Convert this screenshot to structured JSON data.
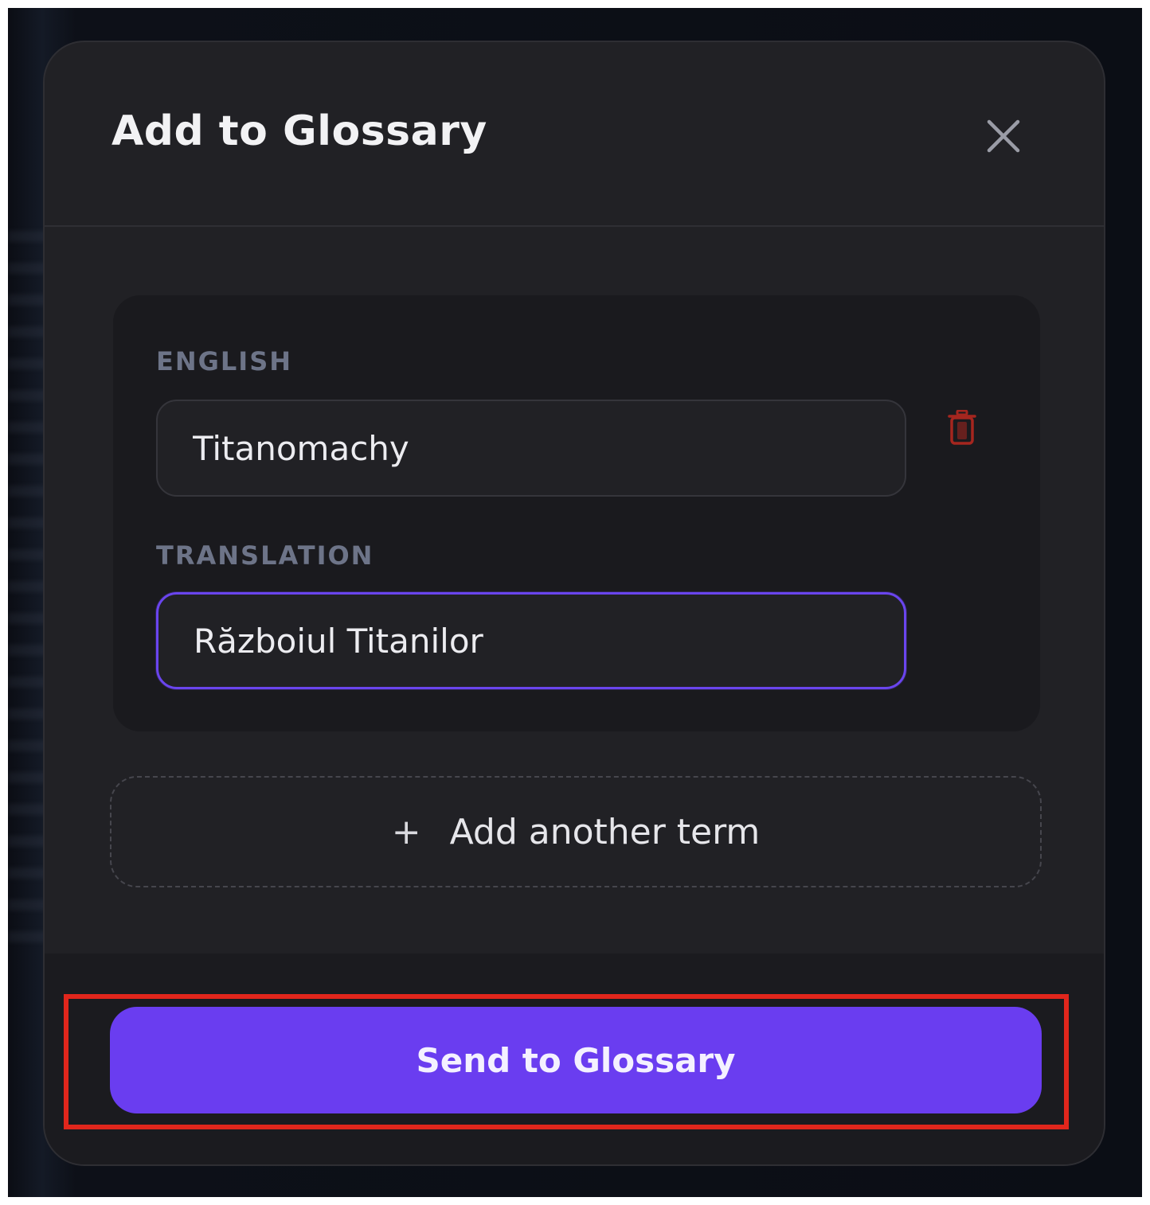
{
  "modal": {
    "title": "Add to Glossary",
    "close_icon": "close-icon"
  },
  "term": {
    "english_label": "ENGLISH",
    "english_value": "Titanomachy",
    "translation_label": "TRANSLATION",
    "translation_value": "Războiul Titanilor",
    "delete_icon": "trash-icon"
  },
  "actions": {
    "add_icon": "plus-icon",
    "add_symbol": "+",
    "add_label": "Add another term",
    "send_label": "Send to Glossary"
  },
  "colors": {
    "accent": "#6a3df0",
    "focus_border": "#6a45ee",
    "delete": "#a5261f",
    "highlight": "#e1261c",
    "modal_bg": "#212125"
  }
}
